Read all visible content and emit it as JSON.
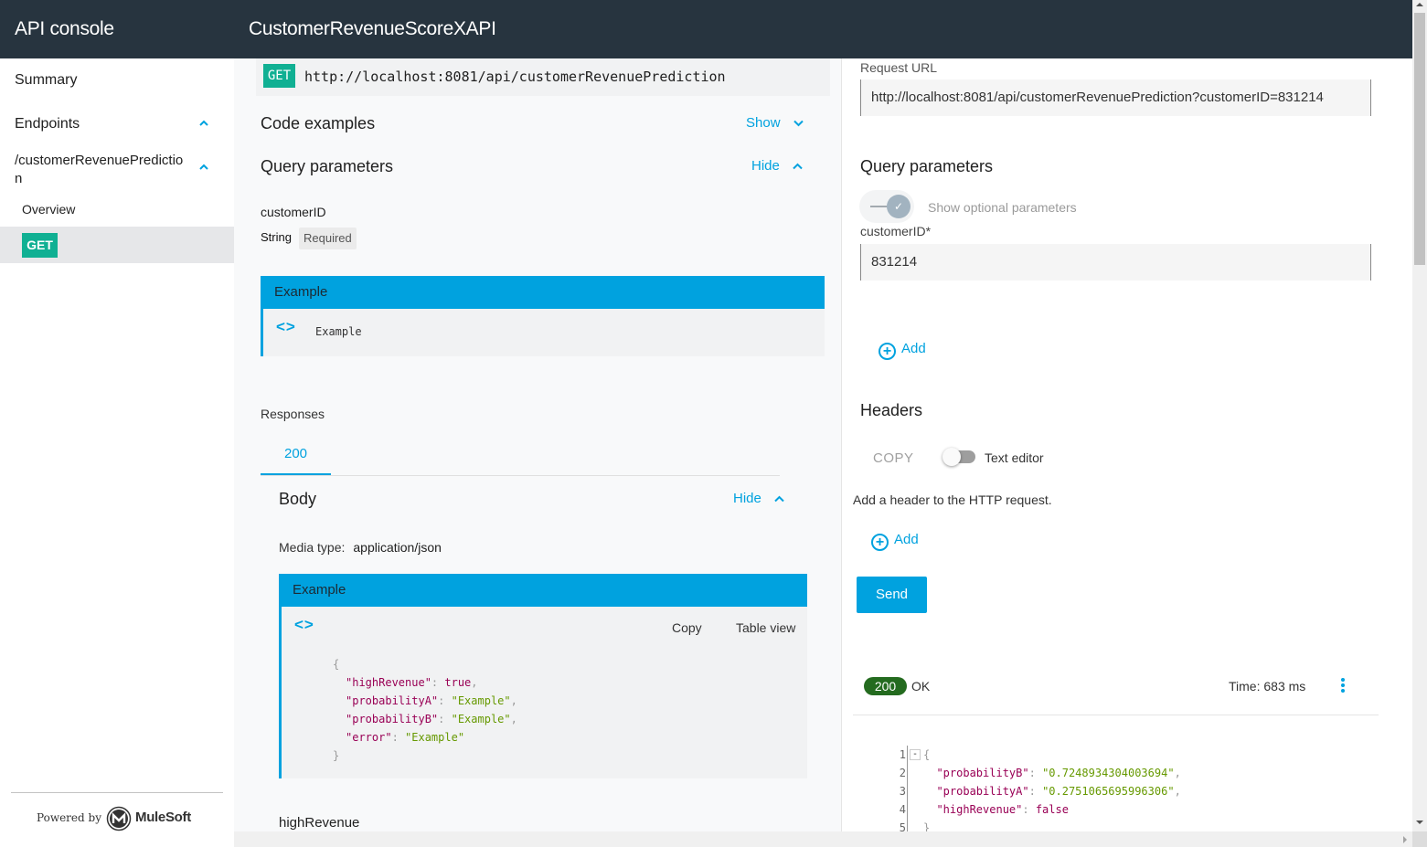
{
  "header": {
    "app_title": "API console",
    "api_title": "CustomerRevenueScoreXAPI"
  },
  "sidebar": {
    "summary": "Summary",
    "endpoints": "Endpoints",
    "endpoint_path": "/customerRevenuePredictio",
    "endpoint_path_wrap": "n",
    "overview": "Overview",
    "method": "GET",
    "powered_by": "Powered by",
    "brand": "MuleSoft"
  },
  "doc": {
    "method": "GET",
    "url": "http://localhost:8081/api/customerRevenuePrediction",
    "code_examples": {
      "title": "Code examples",
      "toggle": "Show"
    },
    "query_params": {
      "title": "Query parameters",
      "toggle": "Hide",
      "params": [
        {
          "name": "customerID",
          "type": "String",
          "badge": "Required"
        }
      ],
      "example_header": "Example",
      "example_value": "Example"
    },
    "responses": {
      "label": "Responses",
      "tabs": [
        "200"
      ],
      "body_title": "Body",
      "body_toggle": "Hide",
      "media_type_label": "Media type:",
      "media_type": "application/json",
      "example_header": "Example",
      "copy": "Copy",
      "table_view": "Table view",
      "example_json": {
        "open": "{",
        "lines": [
          {
            "key": "\"highRevenue\"",
            "value": "true",
            "kind": "bool",
            "trail": ","
          },
          {
            "key": "\"probabilityA\"",
            "value": "\"Example\"",
            "kind": "str",
            "trail": ","
          },
          {
            "key": "\"probabilityB\"",
            "value": "\"Example\"",
            "kind": "str",
            "trail": ","
          },
          {
            "key": "\"error\"",
            "value": "\"Example\"",
            "kind": "str",
            "trail": ""
          }
        ],
        "close": "}"
      },
      "first_field": "highRevenue"
    }
  },
  "request": {
    "url_label": "Request URL",
    "url_value": "http://localhost:8081/api/customerRevenuePrediction?customerID=831214",
    "query_title": "Query parameters",
    "show_optional": "Show optional parameters",
    "param_label": "customerID*",
    "param_value": "831214",
    "add_label": "Add",
    "headers_title": "Headers",
    "copy_label": "COPY",
    "text_editor": "Text editor",
    "headers_hint": "Add a header to the HTTP request.",
    "add_header_label": "Add",
    "send": "Send"
  },
  "response": {
    "status_code": "200",
    "status_text": "OK",
    "time": "Time: 683 ms",
    "line_numbers": [
      "1",
      "2",
      "3",
      "4",
      "5"
    ],
    "lines": [
      {
        "key": "",
        "value": "{",
        "kind": "punct",
        "trail": ""
      },
      {
        "key": "\"probabilityB\"",
        "value": "\"0.7248934304003694\"",
        "kind": "str",
        "trail": ","
      },
      {
        "key": "\"probabilityA\"",
        "value": "\"0.2751065695996306\"",
        "kind": "str",
        "trail": ","
      },
      {
        "key": "\"highRevenue\"",
        "value": "false",
        "kind": "bool",
        "trail": ""
      },
      {
        "key": "",
        "value": "}",
        "kind": "punct",
        "trail": ""
      }
    ]
  },
  "colors": {
    "header_bg": "#27343f",
    "accent": "#00a2df",
    "get_badge": "#10b093",
    "status_ok": "#246b1f"
  }
}
